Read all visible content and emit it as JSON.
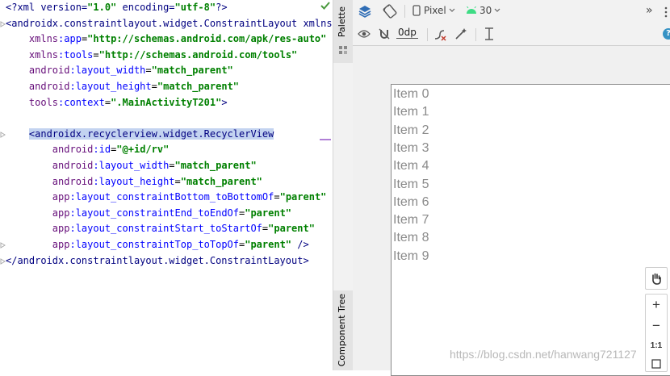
{
  "editor": {
    "lines": [
      {
        "t": "xmldecl",
        "text": "<?xml version=\"1.0\" encoding=\"utf-8\"?>"
      },
      {
        "t": "open",
        "text": "<androidx.constraintlayout.widget.ConstraintLayout xmlns"
      },
      {
        "t": "attr",
        "text": "    xmlns:app=\"http://schemas.android.com/apk/res-auto\""
      },
      {
        "t": "attr",
        "text": "    xmlns:tools=\"http://schemas.android.com/tools\""
      },
      {
        "t": "attr",
        "text": "    android:layout_width=\"match_parent\""
      },
      {
        "t": "attr",
        "text": "    android:layout_height=\"match_parent\""
      },
      {
        "t": "attr",
        "text": "    tools:context=\".MainActivityT201\">"
      },
      {
        "t": "blank",
        "text": ""
      },
      {
        "t": "selected",
        "text": "<androidx.recyclerview.widget.RecyclerView"
      },
      {
        "t": "attr",
        "text": "        android:id=\"@+id/rv\""
      },
      {
        "t": "attr",
        "text": "        android:layout_width=\"match_parent\""
      },
      {
        "t": "attr",
        "text": "        android:layout_height=\"match_parent\""
      },
      {
        "t": "attr",
        "text": "        app:layout_constraintBottom_toBottomOf=\"parent\""
      },
      {
        "t": "attr",
        "text": "        app:layout_constraintEnd_toEndOf=\"parent\""
      },
      {
        "t": "attr",
        "text": "        app:layout_constraintStart_toStartOf=\"parent\""
      },
      {
        "t": "attr",
        "text": "        app:layout_constraintTop_toTopOf=\"parent\" />"
      },
      {
        "t": "close",
        "text": "</androidx.constraintlayout.widget.ConstraintLayout>"
      }
    ]
  },
  "side_tabs": {
    "palette": "Palette",
    "component_tree": "Component Tree"
  },
  "toolbar": {
    "device": "Pixel",
    "api_level": "30",
    "more": "»",
    "margin_value": "0dp",
    "help": "?"
  },
  "preview": {
    "items": [
      "Item 0",
      "Item 1",
      "Item 2",
      "Item 3",
      "Item 4",
      "Item 5",
      "Item 6",
      "Item 7",
      "Item 8",
      "Item 9"
    ]
  },
  "zoom": {
    "zoom_in": "+",
    "zoom_out": "−",
    "actual_size": "1:1"
  },
  "watermark": "https://blog.csdn.net/hanwang721127",
  "colors": {
    "selection": "#c3d3f0",
    "tag": "#000080",
    "attr_ns": "#660e7a",
    "attr_name": "#0000ff",
    "string": "#008000",
    "android_green": "#3ddc84",
    "layers_blue": "#2f6db5",
    "help_blue": "#3592c4"
  }
}
